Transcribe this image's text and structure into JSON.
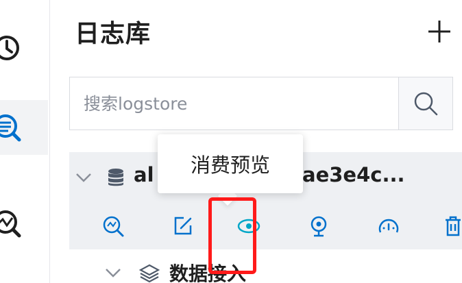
{
  "header": {
    "title": "日志库"
  },
  "search": {
    "placeholder": "搜索logstore"
  },
  "logstore": {
    "name_prefix": "al",
    "name_suffix": "ae3e4c..."
  },
  "tooltip": {
    "text": "消费预览"
  },
  "sub_item": {
    "label": "数据接入"
  },
  "icons": {
    "rail": [
      "history-icon",
      "log-search-icon",
      "analysis-icon"
    ],
    "actions": [
      "query-analysis-icon",
      "edit-icon",
      "consumption-preview-icon",
      "alert-monitor-icon",
      "dashboard-gauge-icon",
      "delete-icon"
    ]
  },
  "colors": {
    "accent": "#0070cc",
    "active_preview": "#00a6c7",
    "highlight": "#ff1a1a",
    "row_bg": "#eef0f3"
  }
}
